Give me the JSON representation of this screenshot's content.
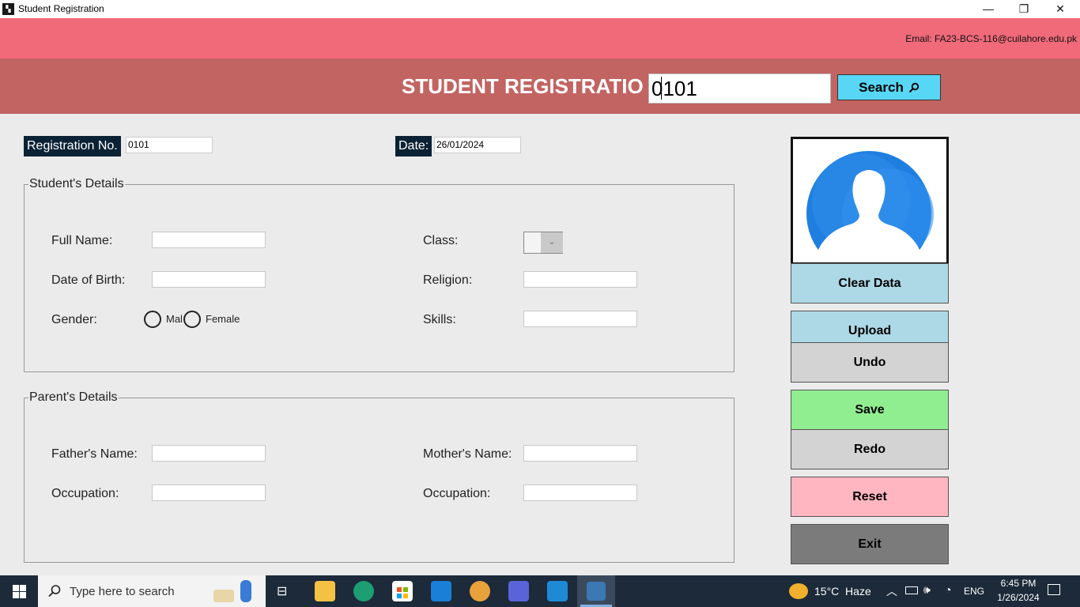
{
  "window": {
    "title": "Student Registration",
    "minimize_glyph": "—",
    "restore_glyph": "❐",
    "close_glyph": "✕"
  },
  "header": {
    "email": "Email: FA23-BCS-116@cuilahore.edu.pk",
    "title": "STUDENT REGISTRATIO",
    "search_value": "0101",
    "search_label": "Search",
    "search_icon": "magnifier-icon"
  },
  "registration": {
    "label": "Registration No.",
    "value": "0101",
    "date_label": "Date:",
    "date_value": "26/01/2024"
  },
  "student": {
    "legend": "Student's Details",
    "full_name_label": "Full Name:",
    "dob_label": "Date of Birth:",
    "gender_label": "Gender:",
    "male_label": "Mal",
    "female_label": "Female",
    "class_label": "Class:",
    "religion_label": "Religion:",
    "skills_label": "Skills:"
  },
  "parent": {
    "legend": "Parent's Details",
    "father_label": "Father's Name:",
    "father_occupation_label": "Occupation:",
    "mother_label": "Mother's Name:",
    "mother_occupation_label": "Occupation:"
  },
  "buttons": {
    "clear": "Clear Data",
    "upload": "Upload",
    "undo": "Undo",
    "save": "Save",
    "redo": "Redo",
    "reset": "Reset",
    "exit": "Exit"
  },
  "colors": {
    "email_band": "#f06a7a",
    "title_band": "#c26462",
    "search_button": "#57d7f5",
    "clear_button": "#add8e6",
    "save_button": "#90ee90",
    "reset_button": "#ffb6c1",
    "exit_button": "#7b7b7b"
  },
  "taskbar": {
    "search_placeholder": "Type here to search",
    "weather": "15°C  Haze",
    "language": "ENG",
    "time": "6:45 PM",
    "date": "1/26/2024"
  }
}
